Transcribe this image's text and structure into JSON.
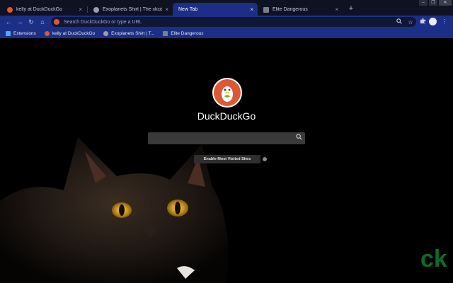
{
  "tabs": [
    {
      "title": "kelly at DuckDuckGo",
      "close": "×",
      "favicon_color": "#de5833",
      "active": false
    },
    {
      "title": "Exoplanets Shirt | The xkcd store",
      "close": "×",
      "favicon_color": "#9aa0ad",
      "active": false
    },
    {
      "title": "New Tab",
      "close": "×",
      "favicon_color": "",
      "active": true
    },
    {
      "title": "Elite Dangerous",
      "close": "×",
      "favicon_color": "#7c7f8a",
      "active": false
    }
  ],
  "new_tab_label": "+",
  "window_controls": [
    "–",
    "❐",
    "✕"
  ],
  "toolbar": {
    "back": "←",
    "forward": "→",
    "reload": "↻",
    "home": "⌂",
    "omnibox_placeholder": "Search DuckDuckGo or type a URL",
    "search_icon": "search-icon",
    "star_icon": "star-icon",
    "extensions_icon": "puzzle-icon",
    "menu": "⋮"
  },
  "bookmarks": [
    {
      "label": "Extensions",
      "icon_color": "#4aa8ff"
    },
    {
      "label": "kelly at DuckDuckGo",
      "icon_color": "#de5833"
    },
    {
      "label": "Exoplanets Shirt | T...",
      "icon_color": "#9aa0ad"
    },
    {
      "label": "Elite Dangerous",
      "icon_color": "#7c7f8a"
    }
  ],
  "main": {
    "brand": "DuckDuckGo",
    "search_placeholder": "",
    "enable_button": "Enable Most Visited Sites",
    "watermark": "ck"
  },
  "colors": {
    "accent": "#1b2f86",
    "duck_orange": "#de5833",
    "background": "#000000"
  }
}
